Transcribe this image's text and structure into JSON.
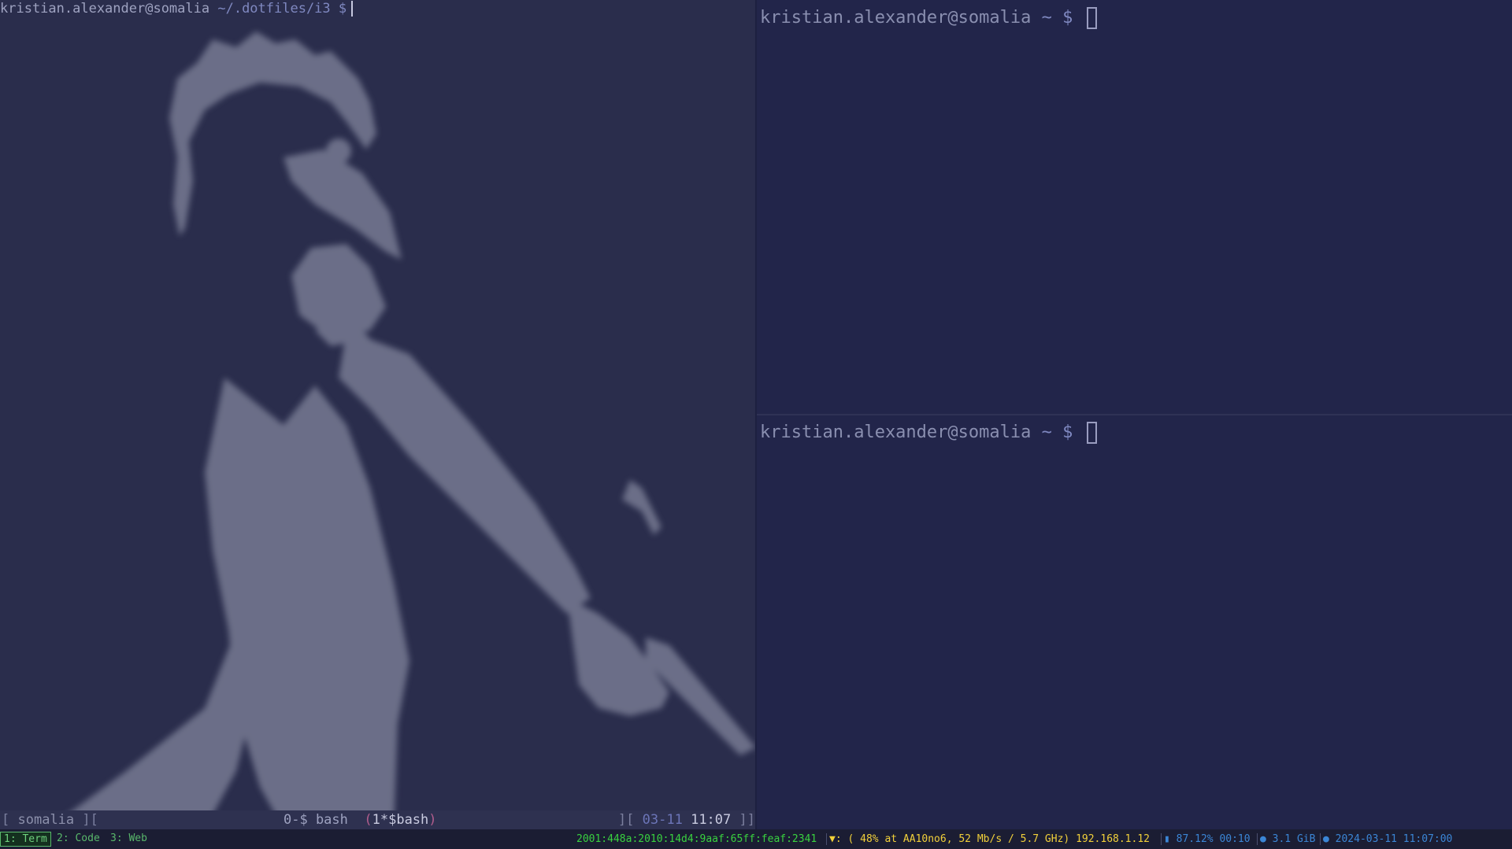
{
  "left_terminal": {
    "user_host": "kristian.alexander@somalia",
    "path": "~/.dotfiles/i3",
    "prompt_symbol": "$"
  },
  "right_top_terminal": {
    "user_host": "kristian.alexander@somalia",
    "path": "~",
    "prompt_symbol": "$"
  },
  "right_bottom_terminal": {
    "user_host": "kristian.alexander@somalia",
    "path": "~",
    "prompt_symbol": "$"
  },
  "tmux": {
    "session_open": "[",
    "session_name": "somalia",
    "session_close": "][",
    "window0": "0-$ bash",
    "window1_open": "(",
    "window1": "1*$bash",
    "window1_close": ")",
    "clock_open": "][",
    "date": "03-11",
    "time": "11:07",
    "clock_close": "]]"
  },
  "i3bar": {
    "workspaces": [
      "1: Term",
      "2: Code",
      "3: Web"
    ],
    "ipv6": "2001:448a:2010:14d4:9aaf:65ff:feaf:2341",
    "wifi": "▼: ( 48% at AA10no6, 52 Mb/s / 5.7 GHz) 192.168.1.12",
    "battery": "▮ 87.12% 00:10",
    "memory": "● 3.1 GiB",
    "datetime": "● 2024-03-11 11:07:00",
    "colors": {
      "ipv6": "#39d23f",
      "wifi": "#f2d13a",
      "info": "#3b86d6",
      "workspace_focused": "#59b86b"
    },
    "tray_icons": [
      "bluetooth-icon",
      "wifi-icon",
      "network-icon"
    ]
  }
}
